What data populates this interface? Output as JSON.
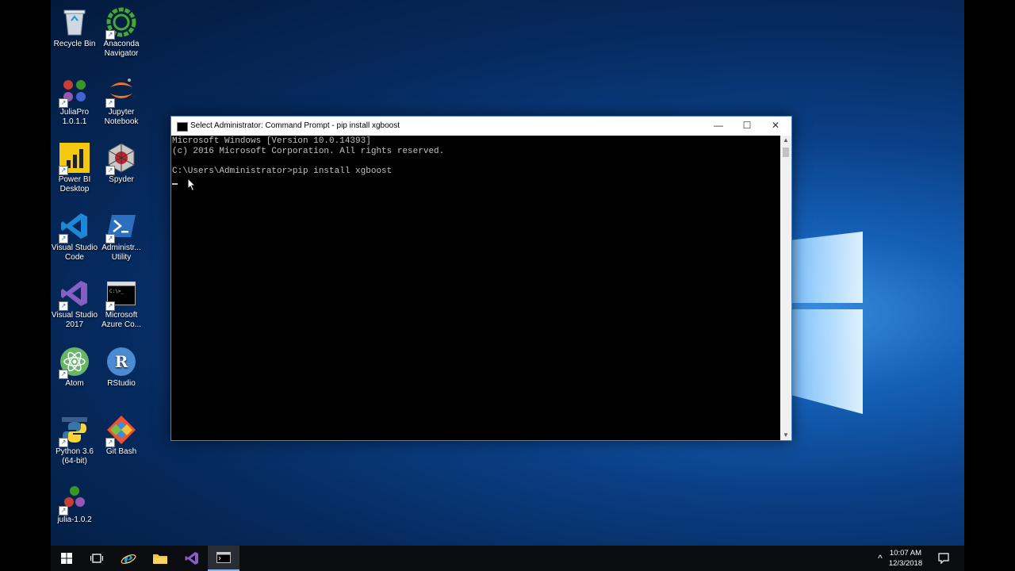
{
  "desktop": {
    "icons": [
      {
        "label": "Recycle Bin",
        "icon": "recycle-bin-icon"
      },
      {
        "label": "Anaconda\nNavigator",
        "icon": "anaconda-icon"
      },
      {
        "label": "JuliaPro\n1.0.1.1",
        "icon": "juliapro-icon"
      },
      {
        "label": "Jupyter\nNotebook",
        "icon": "jupyter-icon"
      },
      {
        "label": "Power BI\nDesktop",
        "icon": "powerbi-icon"
      },
      {
        "label": "Spyder",
        "icon": "spyder-icon"
      },
      {
        "label": "Visual Studio\nCode",
        "icon": "vscode-icon"
      },
      {
        "label": "Administr...\nUtility",
        "icon": "powershell-icon"
      },
      {
        "label": "Visual Studio\n2017",
        "icon": "visual-studio-icon"
      },
      {
        "label": "Microsoft\nAzure Co...",
        "icon": "azure-console-icon"
      },
      {
        "label": "Atom",
        "icon": "atom-icon"
      },
      {
        "label": "RStudio",
        "icon": "rstudio-icon"
      },
      {
        "label": "Python 3.6\n(64-bit)",
        "icon": "python-icon"
      },
      {
        "label": "Git Bash",
        "icon": "git-bash-icon"
      },
      {
        "label": "julia-1.0.2",
        "icon": "julia-icon"
      }
    ]
  },
  "cmd_window": {
    "title": "Select Administrator: Command Prompt - pip  install xgboost",
    "lines": [
      "Microsoft Windows [Version 10.0.14393]",
      "(c) 2016 Microsoft Corporation. All rights reserved.",
      "",
      "C:\\Users\\Administrator>pip install xgboost"
    ],
    "buttons": {
      "minimize": "—",
      "maximize": "☐",
      "close": "✕"
    }
  },
  "taskbar": {
    "items": [
      "start-icon",
      "task-view-icon",
      "internet-explorer-icon",
      "file-explorer-icon",
      "visual-studio-icon",
      "command-prompt-icon"
    ],
    "active": "command-prompt-icon",
    "tray": {
      "chevron": "^",
      "time": "10:07 AM",
      "date": "12/3/2018"
    }
  },
  "colors": {
    "accent": "#0078d7",
    "console_text": "#c0c0c0"
  }
}
